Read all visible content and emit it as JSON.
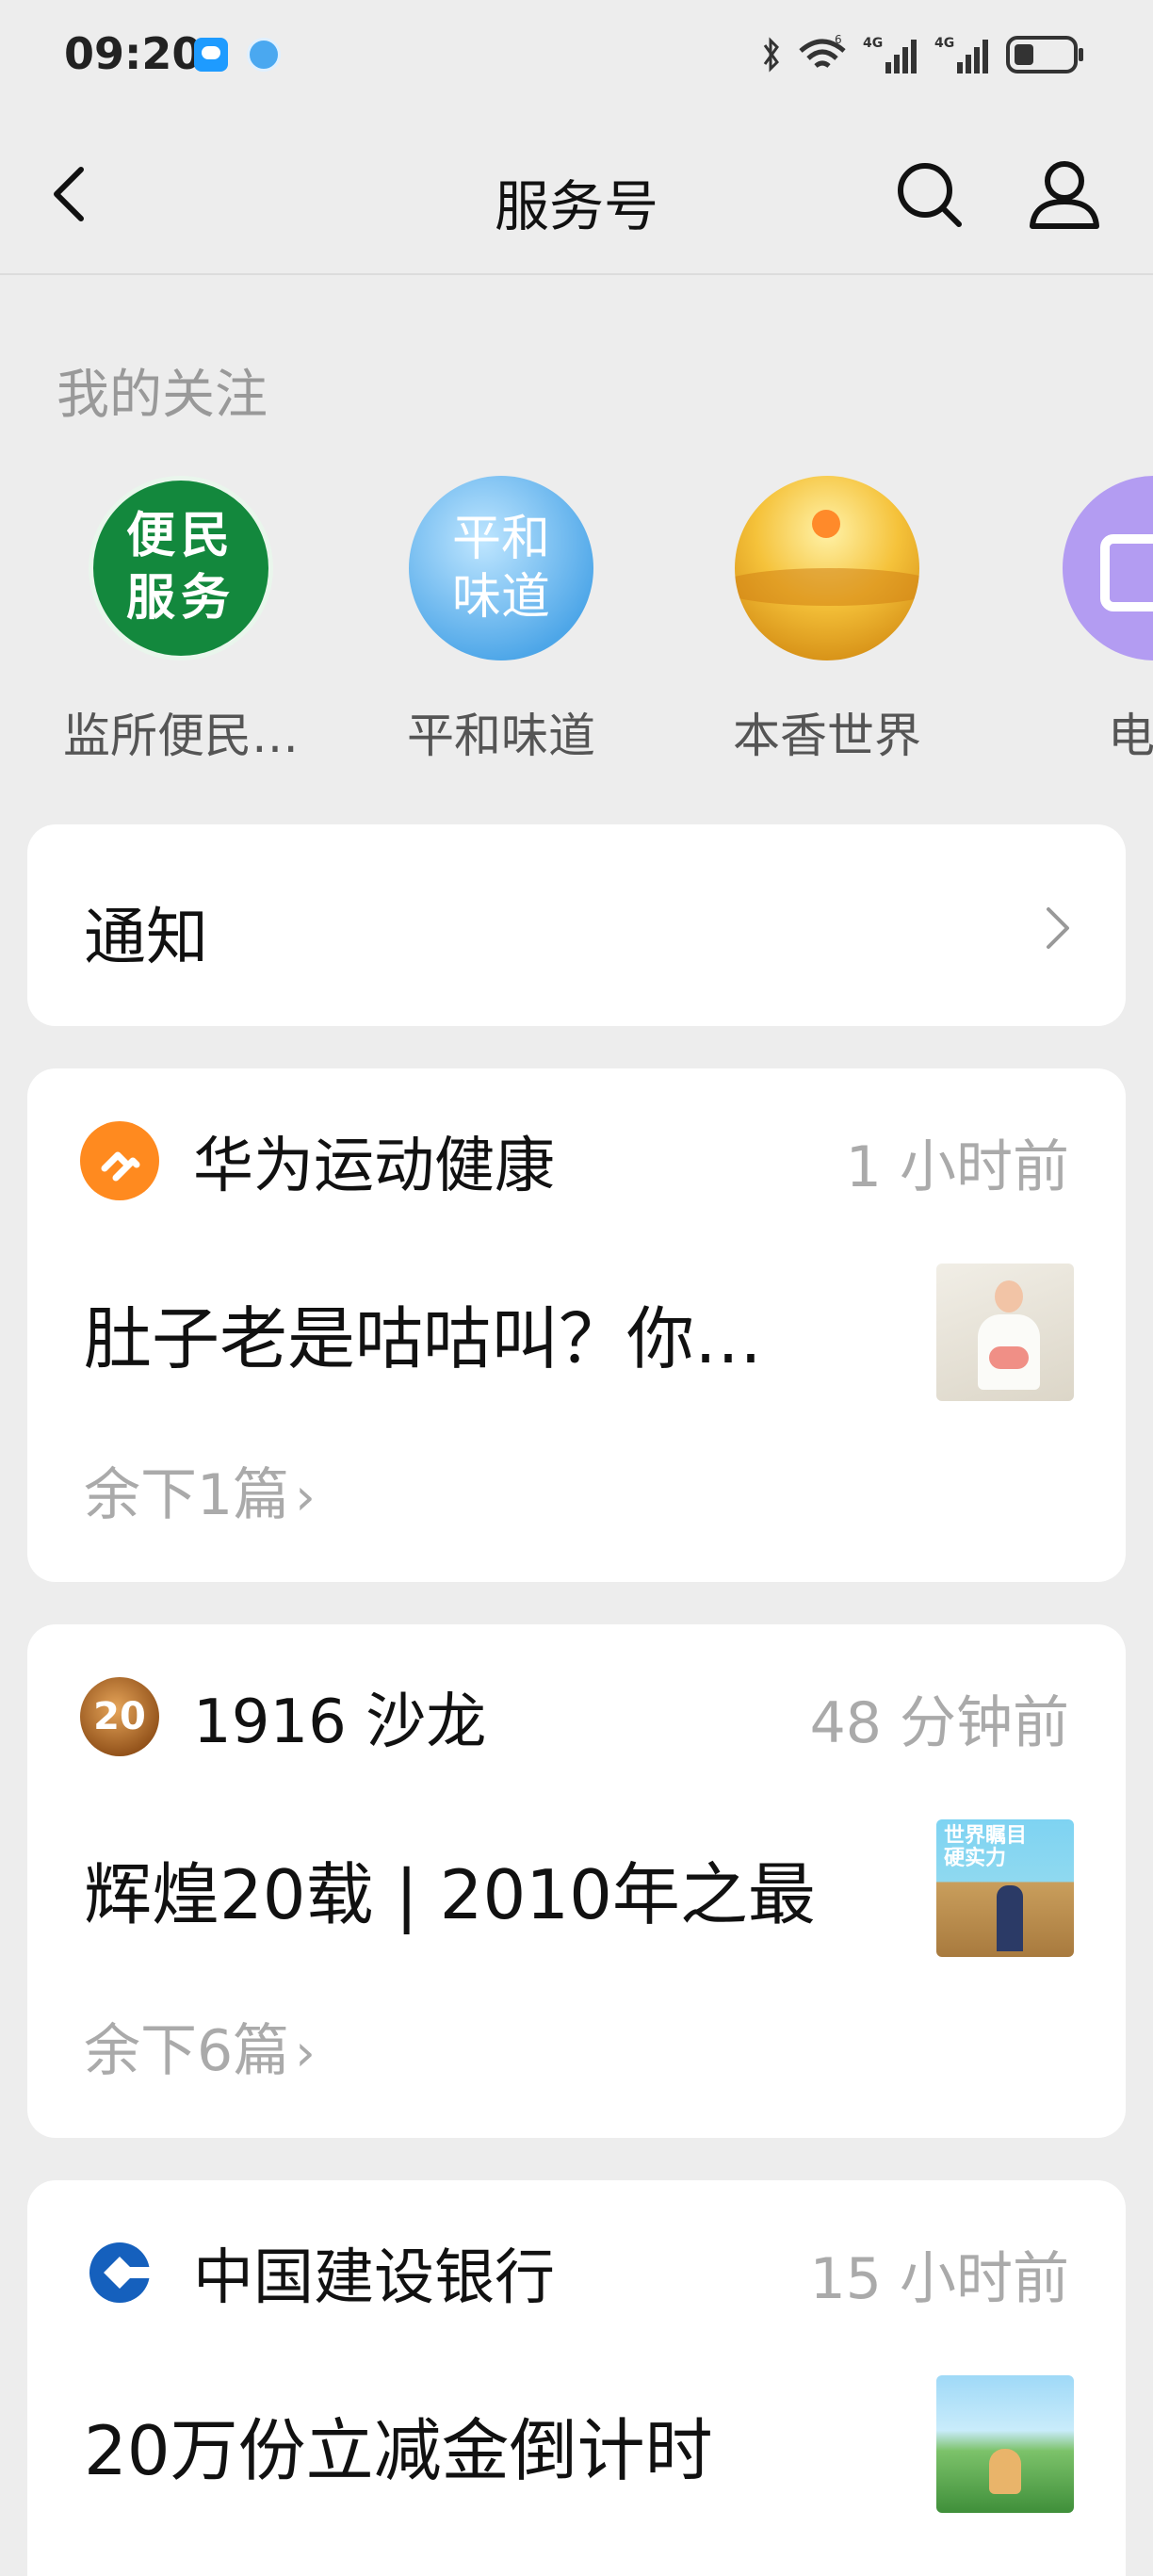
{
  "status_bar": {
    "time": "09:20",
    "icons": [
      "message-notification-icon",
      "browser-notification-icon",
      "bluetooth-icon",
      "wifi-icon",
      "signal-4g-icon",
      "signal-4g-icon",
      "battery-icon"
    ],
    "network_labels": [
      "6",
      "4G",
      "4G"
    ]
  },
  "nav": {
    "title": "服务号",
    "icons": [
      "back-arrow-icon",
      "search-icon",
      "profile-icon"
    ]
  },
  "following": {
    "label": "我的关注",
    "items": [
      {
        "name": "监所便民…",
        "avatar_text": [
          "便民",
          "服务"
        ]
      },
      {
        "name": "平和味道",
        "avatar_text": [
          "平和",
          "味道"
        ]
      },
      {
        "name": "本香世界"
      },
      {
        "name": "电视"
      }
    ]
  },
  "notice": {
    "title": "通知",
    "icon": "chevron-right-icon"
  },
  "feed": [
    {
      "account": "华为运动健康",
      "time": "1 小时前",
      "headline": "肚子老是咕咕叫？你…",
      "more": "余下1篇"
    },
    {
      "account": "1916 沙龙",
      "avatar_text": "20",
      "time": "48 分钟前",
      "headline": "辉煌20载 | 2010年之最",
      "more": "余下6篇",
      "thumb_text": [
        "世界瞩目",
        "硬实力"
      ]
    },
    {
      "account": "中国建设银行",
      "time": "15 小时前",
      "headline": "20万份立减金倒计时"
    }
  ],
  "colors": {
    "background": "#ededed",
    "card": "#ffffff",
    "muted_text": "#aaaaaa",
    "huawei_orange": "#ff8a1f",
    "ccb_blue": "#1560bd"
  }
}
